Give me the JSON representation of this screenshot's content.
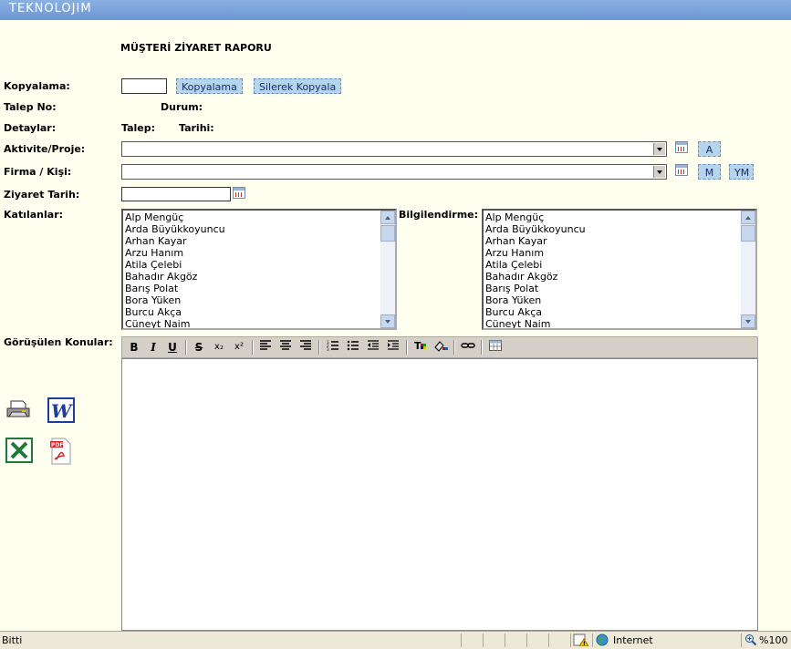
{
  "header": {
    "logo": "TEKNOLOJIM"
  },
  "form": {
    "title": "MÜŞTERİ ZİYARET RAPORU",
    "kopyalama_label": "Kopyalama:",
    "kopyalama_button": "Kopyalama",
    "silerek_kopyala_button": "Silerek Kopyala",
    "talep_no_label": "Talep No:",
    "durum_label": "Durum:",
    "detaylar_label": "Detaylar:",
    "talep_label": "Talep:",
    "tarihi_label": "Tarihi:",
    "aktivite_label": "Aktivite/Proje:",
    "aktivite_button": "A",
    "firma_label": "Firma / Kişi:",
    "firma_m_button": "M",
    "firma_ym_button": "YM",
    "ziyaret_tarih_label": "Ziyaret Tarih:",
    "katilanlar_label": "Katılanlar:",
    "bilgilendirme_label": "Bilgilendirme:",
    "gorusulen_label": "Görüşülen Konular:"
  },
  "people": [
    "Alp Mengüç",
    "Arda Büyükkoyuncu",
    "Arhan Kayar",
    "Arzu Hanım",
    "Atila Çelebi",
    "Bahadır Akgöz",
    "Barış Polat",
    "Bora Yüken",
    "Burcu Akça",
    "Cüneyt Naim"
  ],
  "toolbar": {
    "bold": "B",
    "italic": "I",
    "underline": "U",
    "strike": "S",
    "subscript": "x₂",
    "superscript": "x²"
  },
  "statusbar": {
    "status": "Bitti",
    "zone": "Internet",
    "zoom": "%100"
  },
  "colors": {
    "header_bar": "#6d97d3",
    "page_bg": "#fffff0",
    "button_bg": "#b5d4ee"
  }
}
